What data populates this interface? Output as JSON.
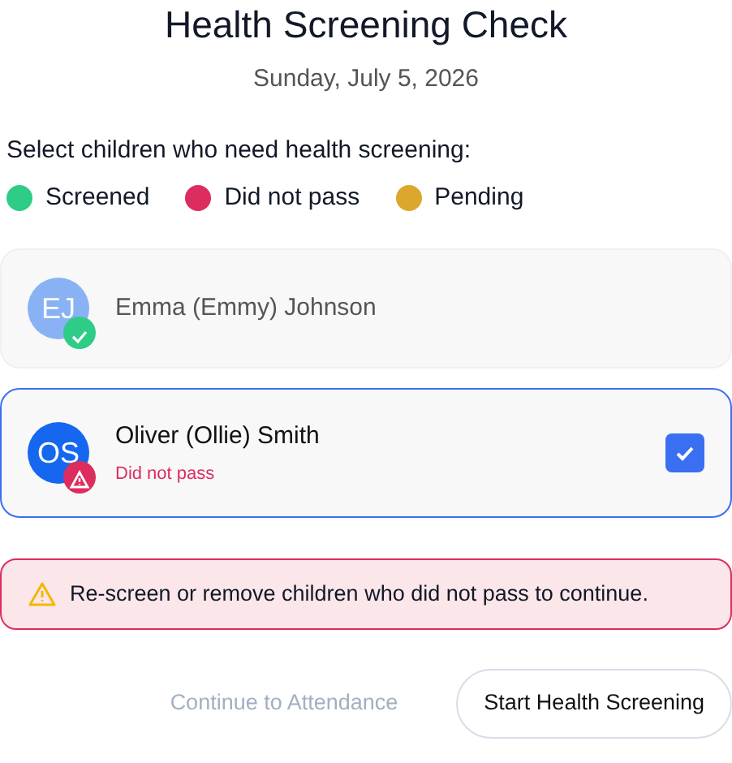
{
  "title": "Health Screening Check",
  "date": "Sunday, July 5, 2026",
  "prompt": "Select children who need health screening:",
  "legend": [
    {
      "label": "Screened",
      "color": "#2ecc87"
    },
    {
      "label": "Did not pass",
      "color": "#dc2d5e"
    },
    {
      "label": "Pending",
      "color": "#dca72d"
    }
  ],
  "children": [
    {
      "initials": "EJ",
      "name": "Emma (Emmy) Johnson",
      "kind": "screened",
      "disabled": true,
      "selected": false
    },
    {
      "initials": "OS",
      "name": "Oliver (Ollie) Smith",
      "kind": "failed",
      "status_text": "Did not pass",
      "disabled": false,
      "selected": true
    }
  ],
  "alert": "Re-screen or remove children who did not pass to continue.",
  "buttons": [
    {
      "label": "Continue to Attendance",
      "disabled": true
    },
    {
      "label": "Start Health Screening",
      "disabled": false
    }
  ]
}
